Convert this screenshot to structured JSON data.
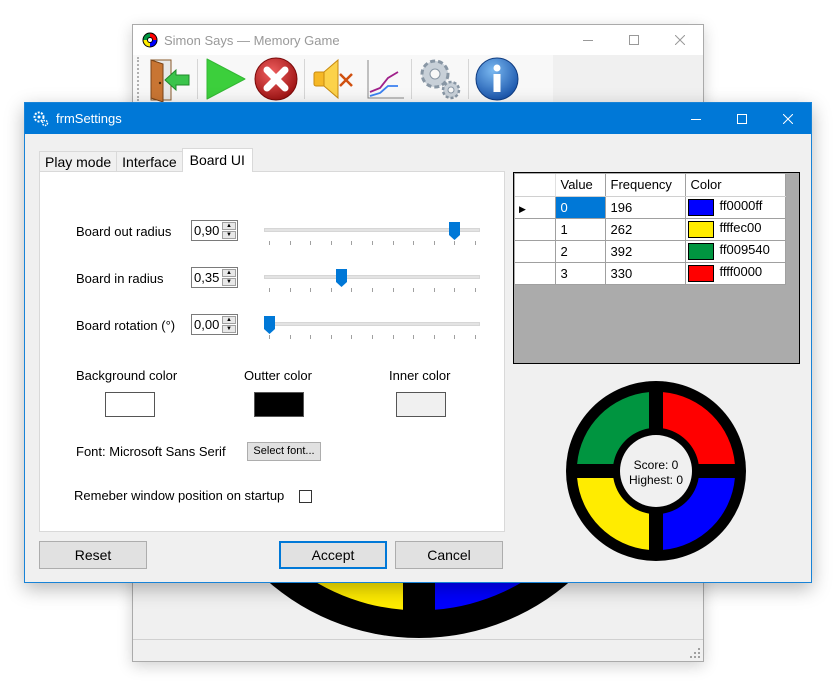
{
  "main_window": {
    "title": "Simon Says — Memory Game",
    "toolbar": [
      {
        "name": "exit",
        "icon": "exit-door-icon"
      },
      {
        "name": "play",
        "icon": "play-icon"
      },
      {
        "name": "stop",
        "icon": "stop-icon"
      },
      {
        "name": "sound",
        "icon": "sound-muted-icon"
      },
      {
        "name": "stats",
        "icon": "chart-icon"
      },
      {
        "name": "settings",
        "icon": "gears-icon"
      },
      {
        "name": "about",
        "icon": "info-icon"
      }
    ]
  },
  "dialog": {
    "title": "frmSettings",
    "tabs": [
      {
        "label": "Play mode",
        "active": false
      },
      {
        "label": "Interface",
        "active": false
      },
      {
        "label": "Board UI",
        "active": true
      }
    ],
    "board_ui": {
      "out_radius": {
        "label": "Board out radius",
        "value": "0,90",
        "slider_fraction": 0.9
      },
      "in_radius": {
        "label": "Board in radius",
        "value": "0,35",
        "slider_fraction": 0.35
      },
      "rotation": {
        "label": "Board rotation (°)",
        "value": "0,00",
        "slider_fraction": 0.0
      },
      "background_color": {
        "label": "Background color",
        "color": "#ffffff"
      },
      "outer_color": {
        "label": "Outter color",
        "color": "#000000"
      },
      "inner_color": {
        "label": "Inner color",
        "color": "#f0f0f0"
      },
      "font_label": "Font: Microsoft Sans Serif",
      "select_font_label": "Select font...",
      "remember_label": "Remeber window position on startup",
      "remember_checked": false
    },
    "grid": {
      "columns": [
        "Value",
        "Frequency",
        "Color"
      ],
      "rows": [
        {
          "value": "0",
          "frequency": "196",
          "color_hex": "#0000ff",
          "color_text": "ff0000ff",
          "selected": true
        },
        {
          "value": "1",
          "frequency": "262",
          "color_hex": "#ffec00",
          "color_text": "ffffec00",
          "selected": false
        },
        {
          "value": "2",
          "frequency": "392",
          "color_hex": "#009540",
          "color_text": "ff009540",
          "selected": false
        },
        {
          "value": "3",
          "frequency": "330",
          "color_hex": "#ff0000",
          "color_text": "ffff0000",
          "selected": false
        }
      ]
    },
    "preview": {
      "score_text": "Score: 0",
      "highest_text": "Highest: 0"
    },
    "buttons": {
      "reset": "Reset",
      "accept": "Accept",
      "cancel": "Cancel"
    }
  }
}
